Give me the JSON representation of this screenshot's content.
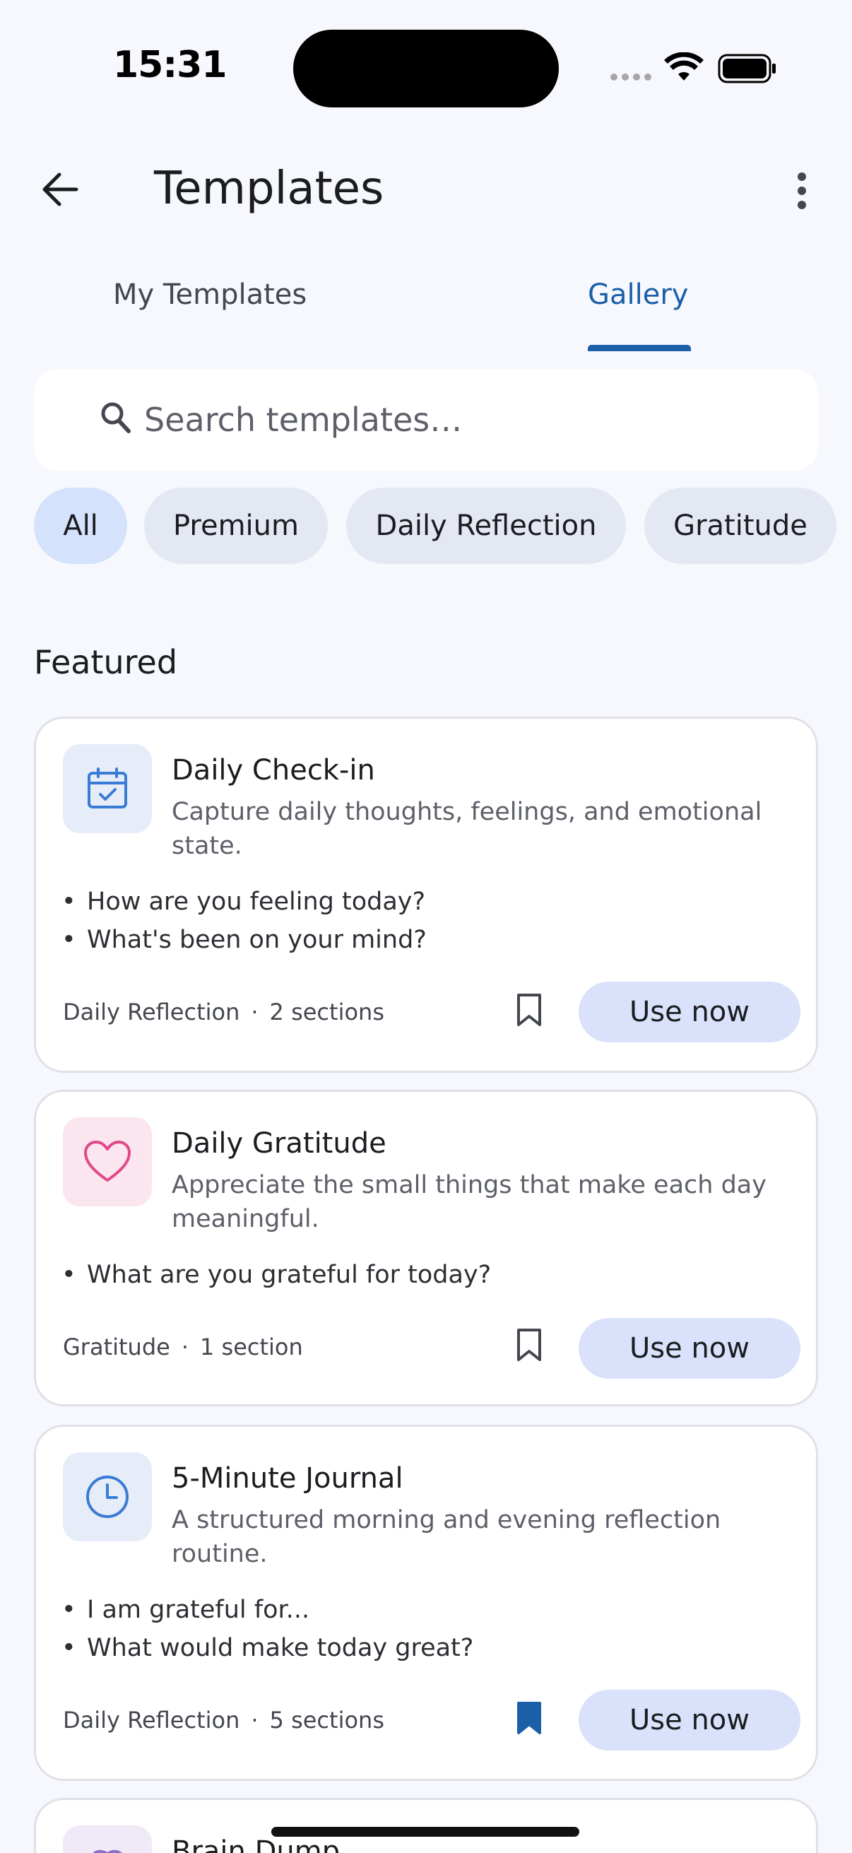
{
  "status_bar": {
    "time": "15:31"
  },
  "app_bar": {
    "title": "Templates"
  },
  "tabs": [
    {
      "label": "My Templates",
      "selected": false
    },
    {
      "label": "Gallery",
      "selected": true
    }
  ],
  "search": {
    "placeholder": "Search templates…",
    "value": ""
  },
  "chips": [
    {
      "label": "All",
      "selected": true
    },
    {
      "label": "Premium",
      "selected": false
    },
    {
      "label": "Daily Reflection",
      "selected": false
    },
    {
      "label": "Gratitude",
      "selected": false
    }
  ],
  "featured": {
    "title": "Featured",
    "cards": [
      {
        "icon": "calendar-check-icon",
        "icon_color": "#3a7bd5",
        "icon_bg": "#e6edf9",
        "title": "Daily Check-in",
        "description": "Capture daily thoughts, feelings, and emotional state.",
        "prompts": [
          "How are you feeling today?",
          "What's been on your mind?"
        ],
        "category": "Daily Reflection",
        "sections": "2 sections",
        "bookmarked": false,
        "action": "Use now"
      },
      {
        "icon": "heart-icon",
        "icon_color": "#e0498a",
        "icon_bg": "#fbe5ef",
        "title": "Daily Gratitude",
        "description": "Appreciate the small things that make each day meaningful.",
        "prompts": [
          "What are you grateful for today?"
        ],
        "category": "Gratitude",
        "sections": "1 section",
        "bookmarked": false,
        "action": "Use now"
      },
      {
        "icon": "clock-icon",
        "icon_color": "#3a7bd5",
        "icon_bg": "#e6edf9",
        "title": "5-Minute Journal",
        "description": "A structured morning and evening reflection routine.",
        "prompts": [
          "I am grateful for...",
          "What would make today great?"
        ],
        "category": "Daily Reflection",
        "sections": "5 sections",
        "bookmarked": true,
        "action": "Use now"
      },
      {
        "icon": "brain-icon",
        "icon_color": "#8a6cc8",
        "icon_bg": "#efe9f8",
        "title": "Brain Dump"
      }
    ]
  },
  "colors": {
    "accent": "#1a5fa8",
    "chip_selected": "#d4e2fb",
    "chip": "#e3e8f3",
    "button": "#d9e2fa"
  }
}
